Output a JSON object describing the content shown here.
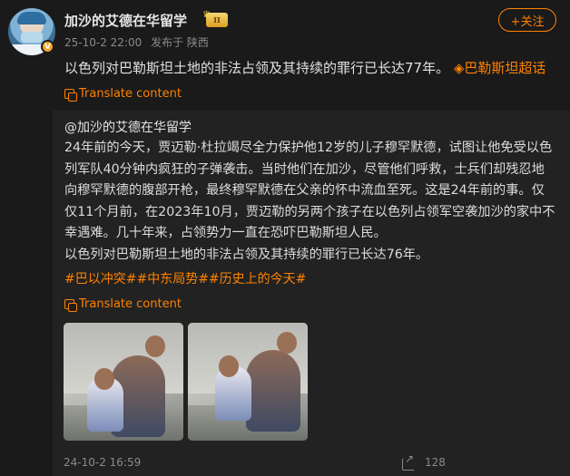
{
  "post": {
    "username": "加沙的艾德在华留学",
    "level_badge": "II",
    "verified_mark": "V",
    "date": "25-10-2 22:00",
    "source": "发布于 陕西",
    "follow_label": "+关注",
    "text": "以色列对巴勒斯坦土地的非法占领及其持续的罪行已长达77年。",
    "supertopic": "巴勒斯坦超话",
    "translate_label": "Translate content"
  },
  "repost": {
    "author": "@加沙的艾德在华留学",
    "lines": [
      "24年前的今天，贾迈勒·杜拉竭尽全力保护他12岁的儿子穆罕默德，试图让他免受以色",
      "列军队40分钟内疯狂的子弹袭击。当时他们在加沙，尽管他们呼救，士兵们却残忍地",
      "向穆罕默德的腹部开枪，最终穆罕默德在父亲的怀中流血至死。这是24年前的事。仅",
      "仅11个月前，在2023年10月，贾迈勒的另两个孩子在以色列占领军空袭加沙的家中不",
      "幸遇难。几十年来，占领势力一直在恐吓巴勒斯坦人民。",
      "以色列对巴勒斯坦土地的非法占领及其持续的罪行已长达76年。"
    ],
    "hashtags": "#巴以冲突##中东局势##历史上的今天#",
    "translate_label": "Translate content",
    "timestamp": "24-10-2 16:59",
    "share_count": "128"
  },
  "colors": {
    "accent": "#ff8200",
    "background": "#1a1a1a",
    "repost_background": "#222222"
  },
  "icons": [
    "verified-icon",
    "level-badge-icon",
    "diamond-topic-icon",
    "translate-icon",
    "share-icon"
  ]
}
